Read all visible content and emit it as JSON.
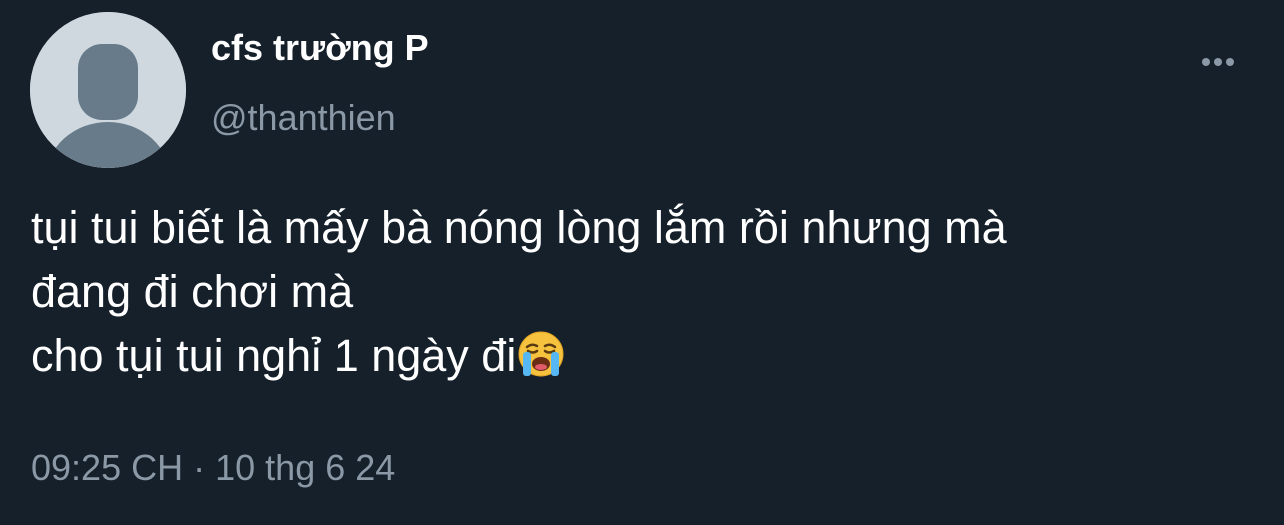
{
  "author": {
    "display_name": "cfs trường P",
    "handle": "@thanthien",
    "avatar_icon": "default-profile-icon"
  },
  "more_icon": "ellipsis-icon",
  "tweet": {
    "lines": [
      "tụi tui biết là mấy bà nóng lòng lắm rồi nhưng mà",
      "đang đi chơi mà",
      "cho tụi tui nghỉ 1 ngày đi"
    ],
    "emoji_icon": "loudly-crying-face-icon"
  },
  "meta": {
    "time": "09:25 CH",
    "separator": "·",
    "date": "10 thg 6 24"
  },
  "colors": {
    "background": "#15202b",
    "text": "#ffffff",
    "secondary_text": "#8b98a5",
    "avatar_bg": "#cfd8de",
    "avatar_fg": "#687b8a"
  }
}
